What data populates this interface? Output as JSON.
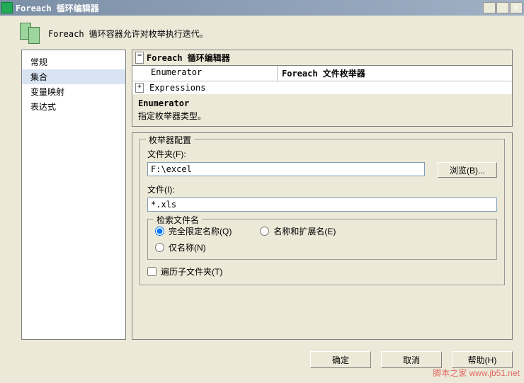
{
  "window": {
    "title": "Foreach 循环编辑器"
  },
  "header": {
    "description": "Foreach 循环容器允许对枚举执行迭代。"
  },
  "sidebar": {
    "items": [
      {
        "label": "常规",
        "selected": false
      },
      {
        "label": "集合",
        "selected": true
      },
      {
        "label": "变量映射",
        "selected": false
      },
      {
        "label": "表达式",
        "selected": false
      }
    ]
  },
  "property_grid": {
    "title": "Foreach 循环编辑器",
    "rows": [
      {
        "label": "Enumerator",
        "value": "Foreach 文件枚举器"
      },
      {
        "label": "Expressions",
        "value": ""
      }
    ],
    "desc_title": "Enumerator",
    "desc_text": "指定枚举器类型。"
  },
  "config": {
    "legend": "枚举器配置",
    "folder_label": "文件夹(F):",
    "folder_value": "F:\\excel",
    "browse_label": "浏览(B)...",
    "files_label": "文件(I):",
    "files_value": "*.xls",
    "retrieve_legend": "检索文件名",
    "radios": {
      "fully_qualified": "完全限定名称(Q)",
      "name_ext": "名称和扩展名(E)",
      "name_only": "仅名称(N)"
    },
    "traverse_label": "遍历子文件夹(T)"
  },
  "buttons": {
    "ok": "确定",
    "cancel": "取消",
    "help": "帮助(H)"
  },
  "watermark": "脚本之家\nwww.jb51.net"
}
